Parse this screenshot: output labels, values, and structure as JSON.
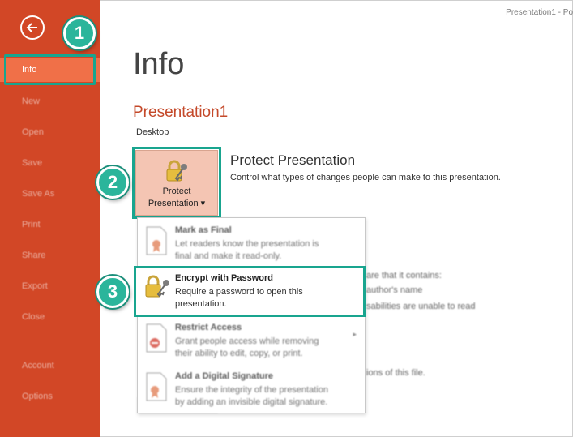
{
  "window": {
    "title": "Presentation1 - Po"
  },
  "sidebar": {
    "items": [
      {
        "label": "Info"
      },
      {
        "label": "New"
      },
      {
        "label": "Open"
      },
      {
        "label": "Save"
      },
      {
        "label": "Save As"
      },
      {
        "label": "Print"
      },
      {
        "label": "Share"
      },
      {
        "label": "Export"
      },
      {
        "label": "Close"
      },
      {
        "label": "Account"
      },
      {
        "label": "Options"
      }
    ]
  },
  "steps": [
    "1",
    "2",
    "3"
  ],
  "main": {
    "title": "Info",
    "document_name": "Presentation1",
    "location": "Desktop",
    "protect": {
      "button_line1": "Protect",
      "button_line2": "Presentation ▾",
      "heading": "Protect Presentation",
      "description": "Control what types of changes people can make to this presentation."
    },
    "background_lines": [
      "are that it contains:",
      "author's name",
      "sabilities are unable to read",
      "ions of this file."
    ]
  },
  "menu": {
    "items": [
      {
        "title": "Mark as Final",
        "desc1": "Let readers know the presentation is",
        "desc2": "final and make it read-only."
      },
      {
        "title": "Encrypt with Password",
        "desc1": "Require a password to open this",
        "desc2": "presentation."
      },
      {
        "title": "Restrict Access",
        "desc1": "Grant people access while removing",
        "desc2": "their ability to edit, copy, or print.",
        "arrow": "▸"
      },
      {
        "title": "Add a Digital Signature",
        "desc1": "Ensure the integrity of the presentation",
        "desc2": "by adding an invisible digital signature."
      }
    ]
  },
  "colors": {
    "sidebar": "#d24726",
    "sidebar_active": "#f07048",
    "highlight": "#19a58f",
    "doc_name": "#c4492a"
  },
  "icons": [
    "back-arrow-icon",
    "lock-key-icon",
    "document-ribbon-icon",
    "no-entry-icon",
    "signature-icon"
  ]
}
